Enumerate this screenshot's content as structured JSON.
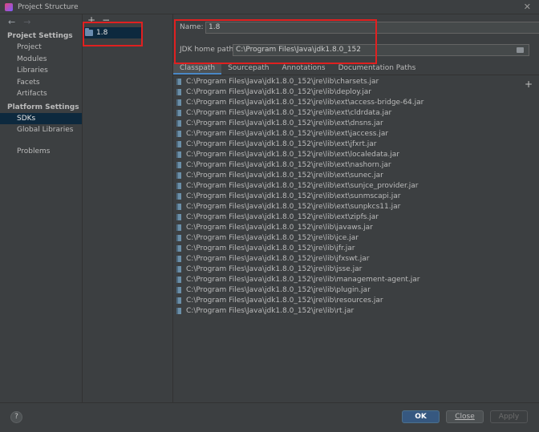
{
  "window": {
    "title": "Project Structure",
    "close_glyph": "✕"
  },
  "nav": {
    "back_glyph": "←",
    "forward_glyph": "→",
    "project_settings_header": "Project Settings",
    "project_settings_items": [
      "Project",
      "Modules",
      "Libraries",
      "Facets",
      "Artifacts"
    ],
    "platform_settings_header": "Platform Settings",
    "platform_settings_items": [
      "SDKs",
      "Global Libraries"
    ],
    "problems": "Problems"
  },
  "sdk_list": {
    "add_glyph": "+",
    "remove_glyph": "−",
    "items": [
      "1.8"
    ]
  },
  "sdk_details": {
    "name_label": "Name:",
    "name_value": "1.8",
    "home_path_label": "JDK home path:",
    "home_path_value": "C:\\Program Files\\Java\\jdk1.8.0_152"
  },
  "tabs": [
    "Classpath",
    "Sourcepath",
    "Annotations",
    "Documentation Paths"
  ],
  "add_glyph": "+",
  "classpath": [
    "C:\\Program Files\\Java\\jdk1.8.0_152\\jre\\lib\\charsets.jar",
    "C:\\Program Files\\Java\\jdk1.8.0_152\\jre\\lib\\deploy.jar",
    "C:\\Program Files\\Java\\jdk1.8.0_152\\jre\\lib\\ext\\access-bridge-64.jar",
    "C:\\Program Files\\Java\\jdk1.8.0_152\\jre\\lib\\ext\\cldrdata.jar",
    "C:\\Program Files\\Java\\jdk1.8.0_152\\jre\\lib\\ext\\dnsns.jar",
    "C:\\Program Files\\Java\\jdk1.8.0_152\\jre\\lib\\ext\\jaccess.jar",
    "C:\\Program Files\\Java\\jdk1.8.0_152\\jre\\lib\\ext\\jfxrt.jar",
    "C:\\Program Files\\Java\\jdk1.8.0_152\\jre\\lib\\ext\\localedata.jar",
    "C:\\Program Files\\Java\\jdk1.8.0_152\\jre\\lib\\ext\\nashorn.jar",
    "C:\\Program Files\\Java\\jdk1.8.0_152\\jre\\lib\\ext\\sunec.jar",
    "C:\\Program Files\\Java\\jdk1.8.0_152\\jre\\lib\\ext\\sunjce_provider.jar",
    "C:\\Program Files\\Java\\jdk1.8.0_152\\jre\\lib\\ext\\sunmscapi.jar",
    "C:\\Program Files\\Java\\jdk1.8.0_152\\jre\\lib\\ext\\sunpkcs11.jar",
    "C:\\Program Files\\Java\\jdk1.8.0_152\\jre\\lib\\ext\\zipfs.jar",
    "C:\\Program Files\\Java\\jdk1.8.0_152\\jre\\lib\\javaws.jar",
    "C:\\Program Files\\Java\\jdk1.8.0_152\\jre\\lib\\jce.jar",
    "C:\\Program Files\\Java\\jdk1.8.0_152\\jre\\lib\\jfr.jar",
    "C:\\Program Files\\Java\\jdk1.8.0_152\\jre\\lib\\jfxswt.jar",
    "C:\\Program Files\\Java\\jdk1.8.0_152\\jre\\lib\\jsse.jar",
    "C:\\Program Files\\Java\\jdk1.8.0_152\\jre\\lib\\management-agent.jar",
    "C:\\Program Files\\Java\\jdk1.8.0_152\\jre\\lib\\plugin.jar",
    "C:\\Program Files\\Java\\jdk1.8.0_152\\jre\\lib\\resources.jar",
    "C:\\Program Files\\Java\\jdk1.8.0_152\\jre\\lib\\rt.jar"
  ],
  "buttons": {
    "help": "?",
    "ok": "OK",
    "close": "Close",
    "apply": "Apply"
  },
  "colors": {
    "selection": "#0d293e",
    "accent": "#365880",
    "annotation": "#e02020"
  }
}
